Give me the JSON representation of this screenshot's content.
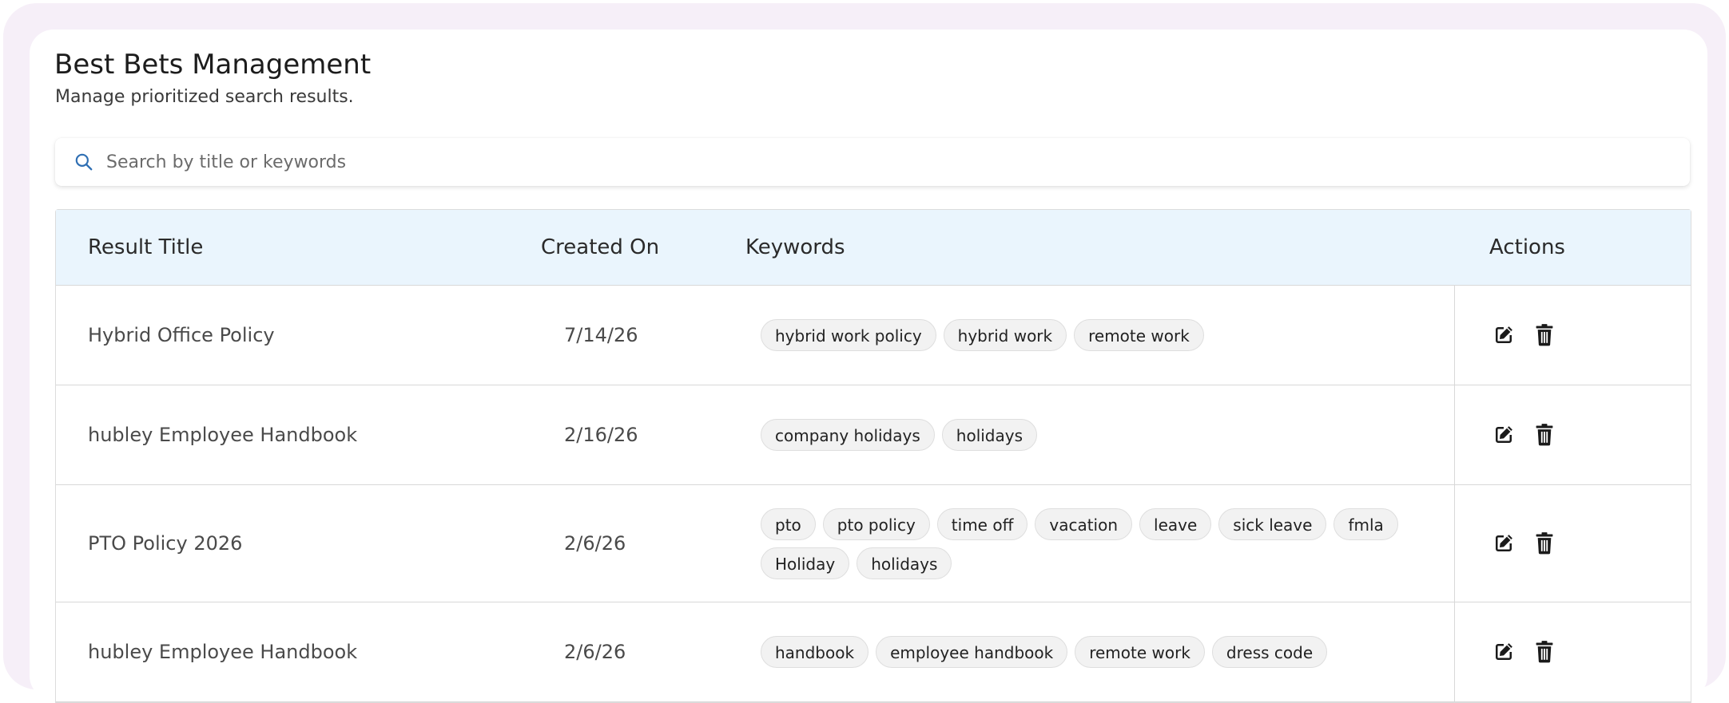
{
  "header": {
    "title": "Best Bets Management",
    "subtitle": "Manage prioritized search results."
  },
  "search": {
    "placeholder": "Search by title or keywords",
    "value": ""
  },
  "table": {
    "columns": {
      "title": "Result Title",
      "created": "Created On",
      "keywords": "Keywords",
      "actions": "Actions"
    },
    "rows": [
      {
        "title": "Hybrid Office Policy",
        "created": "7/14/26",
        "keywords": [
          "hybrid work policy",
          "hybrid work",
          "remote work"
        ]
      },
      {
        "title": "hubley Employee Handbook",
        "created": "2/16/26",
        "keywords": [
          "company holidays",
          "holidays"
        ]
      },
      {
        "title": "PTO Policy 2026",
        "created": "2/6/26",
        "keywords": [
          "pto",
          "pto policy",
          "time off",
          "vacation",
          "leave",
          "sick leave",
          "fmla",
          "Holiday",
          "holidays"
        ]
      },
      {
        "title": "hubley Employee Handbook",
        "created": "2/6/26",
        "keywords": [
          "handbook",
          "employee handbook",
          "remote work",
          "dress code"
        ]
      }
    ]
  },
  "icons": {
    "search": "search-icon",
    "edit": "edit-icon",
    "delete": "trash-icon"
  },
  "colors": {
    "frame": "#f6eff8",
    "header_bg": "#eaf5fd",
    "search_icon": "#2f6fb3",
    "chip_bg": "#f2f2f2"
  }
}
